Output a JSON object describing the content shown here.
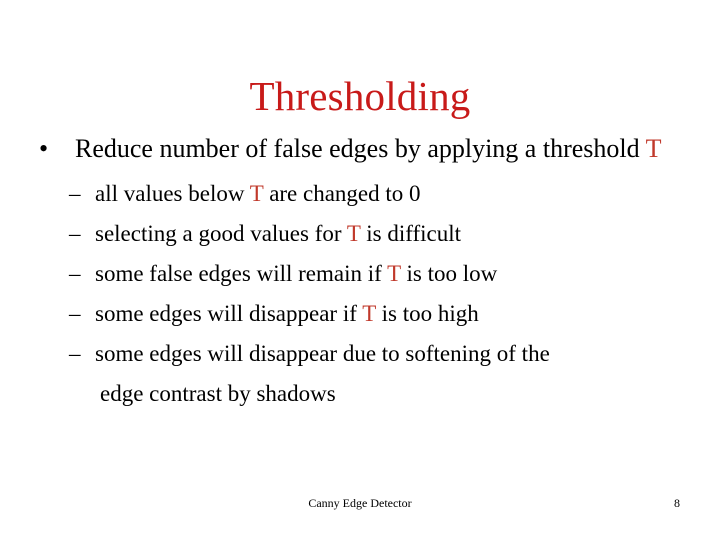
{
  "slide": {
    "title": "Thresholding",
    "title_color": "#c81a19",
    "accent_color": "#c0392b",
    "background_color": "#ffffff",
    "text_color": "#000000"
  },
  "content": {
    "bullet": {
      "marker": "•",
      "text_before": "Reduce number of false edges by applying a threshold ",
      "symbol": "T",
      "text_after": ""
    },
    "sub_bullets": [
      {
        "marker": "–",
        "text_before": "all values below ",
        "symbol": "T",
        "text_after": " are changed to 0",
        "wrap_text": ""
      },
      {
        "marker": "–",
        "text_before": "selecting a good values for ",
        "symbol": "T",
        "text_after": " is difficult",
        "wrap_text": ""
      },
      {
        "marker": "–",
        "text_before": "some false edges will remain if ",
        "symbol": "T",
        "text_after": " is too low",
        "wrap_text": ""
      },
      {
        "marker": "–",
        "text_before": "some edges will disappear if ",
        "symbol": "T",
        "text_after": " is too high",
        "wrap_text": ""
      },
      {
        "marker": "–",
        "text_before": "some edges will disappear due to softening of the",
        "symbol": "",
        "text_after": "",
        "wrap_text": "edge contrast by shadows"
      }
    ]
  },
  "footer": {
    "label": "Canny Edge Detector",
    "page_number": "8"
  }
}
